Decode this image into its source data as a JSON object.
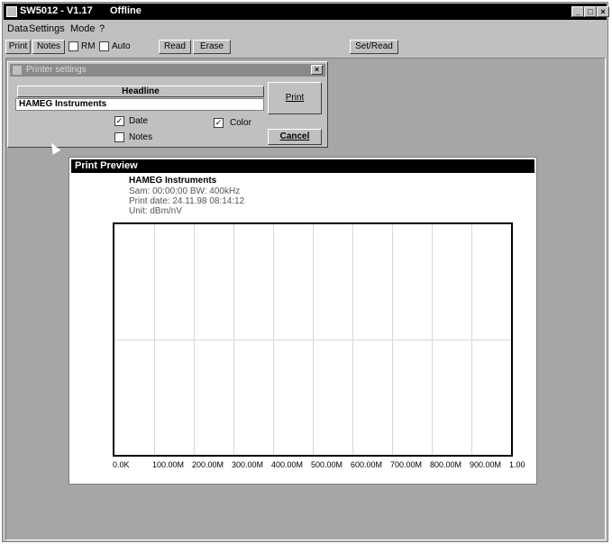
{
  "app": {
    "title": "SW5012 - V1.17",
    "status": "Offline"
  },
  "menu": [
    "Data",
    "Settings",
    "Mode",
    "?"
  ],
  "toolbar": {
    "print": "Print",
    "notes": "Notes",
    "rm_label": "RM",
    "auto_label": "Auto",
    "read": "Read",
    "erase": "Erase",
    "set_read": "Set/Read"
  },
  "printer_dialog": {
    "title": "Printer settings",
    "headline_header": "Headline",
    "headline_value": "HAMEG Instruments",
    "date_label": "Date",
    "date_checked": true,
    "color_label": "Color",
    "color_checked": true,
    "notes_label": "Notes",
    "notes_checked": false,
    "print_button": "Print",
    "cancel_button": "Cancel",
    "close_glyph": "×"
  },
  "print_preview": {
    "title": "Print Preview",
    "headline": "HAMEG Instruments",
    "scan_info": "Sam: 00:00:00  BW: 400kHz",
    "print_date": "Print date: 24.11.98 08:14:12",
    "unit": "Unit: dBm/nV"
  },
  "chart_data": {
    "type": "line",
    "x_tick_labels": [
      "0.0K",
      "100.00M",
      "200.00M",
      "300.00M",
      "400.00M",
      "500.00M",
      "600.00M",
      "700.00M",
      "800.00M",
      "900.00M",
      "1.00"
    ],
    "grid": true,
    "series": []
  }
}
